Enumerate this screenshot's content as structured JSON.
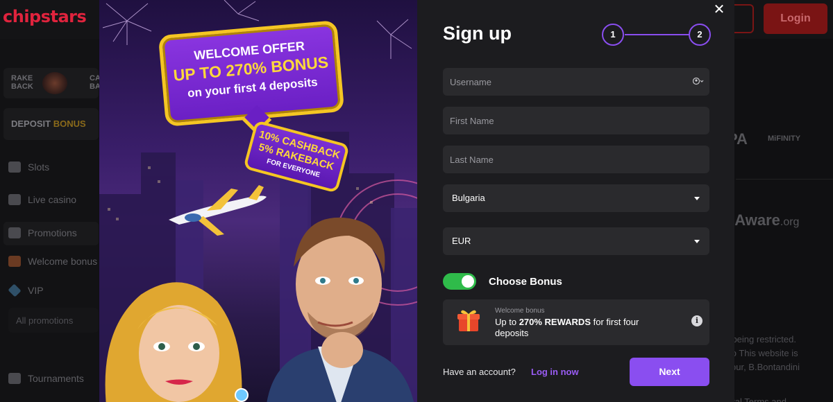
{
  "background": {
    "logo": "chipstars",
    "login_label": "Login",
    "rake_left": "RAKE BACK",
    "rake_right": "CA BA",
    "deposit_bonus": {
      "prefix": "DEPOSIT ",
      "accent": "BONUS"
    },
    "sidebar_items": [
      "Slots",
      "Live casino",
      "Promotions",
      "Welcome bonus",
      "VIP",
      "All promotions",
      "Tournaments"
    ],
    "partner_logo_1": "PA",
    "partner_logo_2": "MiFINITY",
    "aware_main": "eAware",
    "aware_suffix": ".org",
    "footer_lines": [
      "ot being restricted.",
      "çao This website is",
      "alibur, B.Bontandini",
      "neral Terms and"
    ]
  },
  "promo_art": {
    "headline_1": "WELCOME OFFER",
    "headline_2": "UP TO 270% BONUS",
    "headline_3": "on your first 4 deposits",
    "tag_1": "10% CASHBACK",
    "tag_2": "5% RAKEBACK",
    "tag_3": "FOR EVERYONE"
  },
  "form": {
    "title": "Sign up",
    "steps": [
      "1",
      "2"
    ],
    "username_placeholder": "Username",
    "first_name_placeholder": "First Name",
    "last_name_placeholder": "Last Name",
    "country_value": "Bulgaria",
    "currency_value": "EUR",
    "bonus_toggle_label": "Choose Bonus",
    "bonus_toggle_on": true,
    "bonus_caption": "Welcome bonus",
    "bonus_text_prefix": "Up to ",
    "bonus_text_bold": "270% REWARDS",
    "bonus_text_suffix": " for first four deposits",
    "have_account": "Have an account?",
    "login_link": "Log in now",
    "next_label": "Next",
    "close_label": "✕"
  },
  "colors": {
    "accent": "#8a4ef0",
    "toggle_on": "#2fbb4a",
    "brand_red": "#e0233d",
    "gold": "#f5c623"
  }
}
